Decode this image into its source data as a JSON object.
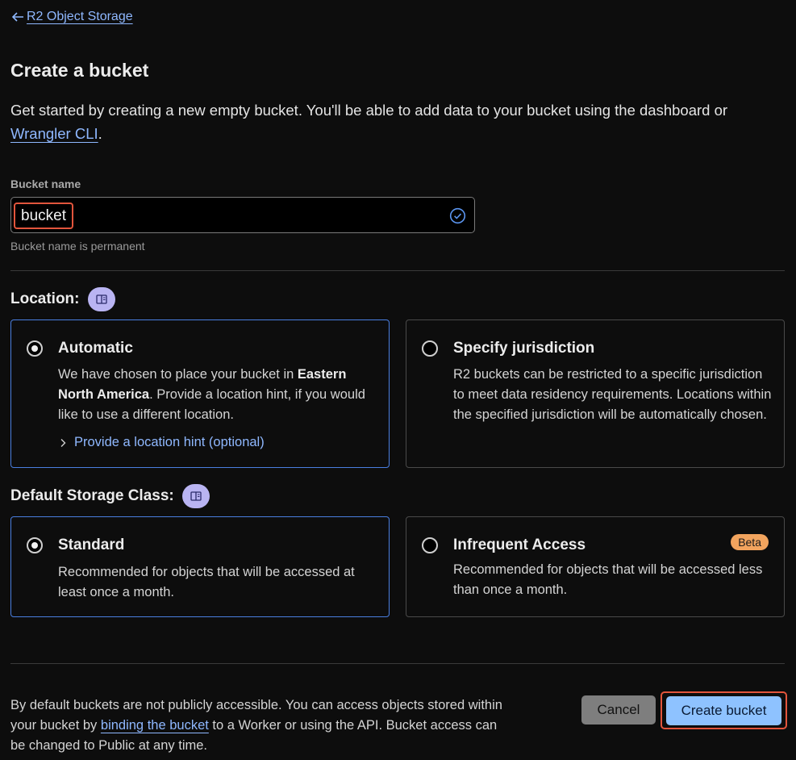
{
  "nav": {
    "back_label": "R2 Object Storage"
  },
  "page": {
    "title": "Create a bucket",
    "intro_text": "Get started by creating a new empty bucket. You'll be able to add data to your bucket using the dashboard or ",
    "intro_link": "Wrangler CLI",
    "intro_end": "."
  },
  "bucket_name": {
    "label": "Bucket name",
    "value": "bucket",
    "hint": "Bucket name is permanent"
  },
  "location": {
    "label": "Location:",
    "options": [
      {
        "title": "Automatic",
        "desc_pre": "We have chosen to place your bucket in ",
        "desc_bold": "Eastern North America",
        "desc_post": ". Provide a location hint, if you would like to use a different location.",
        "link": "Provide a location hint (optional)",
        "selected": true
      },
      {
        "title": "Specify jurisdiction",
        "desc": "R2 buckets can be restricted to a specific jurisdiction to meet data residency requirements. Locations within the specified jurisdiction will be automatically chosen.",
        "selected": false
      }
    ]
  },
  "storage_class": {
    "label": "Default Storage Class:",
    "options": [
      {
        "title": "Standard",
        "desc": "Recommended for objects that will be accessed at least once a month.",
        "selected": true
      },
      {
        "title": "Infrequent Access",
        "badge": "Beta",
        "desc": "Recommended for objects that will be accessed less than once a month.",
        "selected": false
      }
    ]
  },
  "footer": {
    "note_pre": "By default buckets are not publicly accessible. You can access objects stored within your bucket by ",
    "note_link": "binding the bucket",
    "note_post": " to a Worker or using the API. Bucket access can be changed to Public at any time.",
    "cancel_label": "Cancel",
    "create_label": "Create bucket"
  },
  "colors": {
    "background": "#0d0d0d",
    "link": "#8fb8ff",
    "selected_border": "#4a7fe0",
    "primary_button": "#8ec2ff",
    "highlight": "#e2553c",
    "badge": "#f2a45e",
    "doc_badge": "#b9b4f2"
  },
  "icons": {
    "back": "arrow-left-icon",
    "valid": "check-circle-icon",
    "docs": "book-open-icon",
    "expand": "chevron-right-icon"
  }
}
